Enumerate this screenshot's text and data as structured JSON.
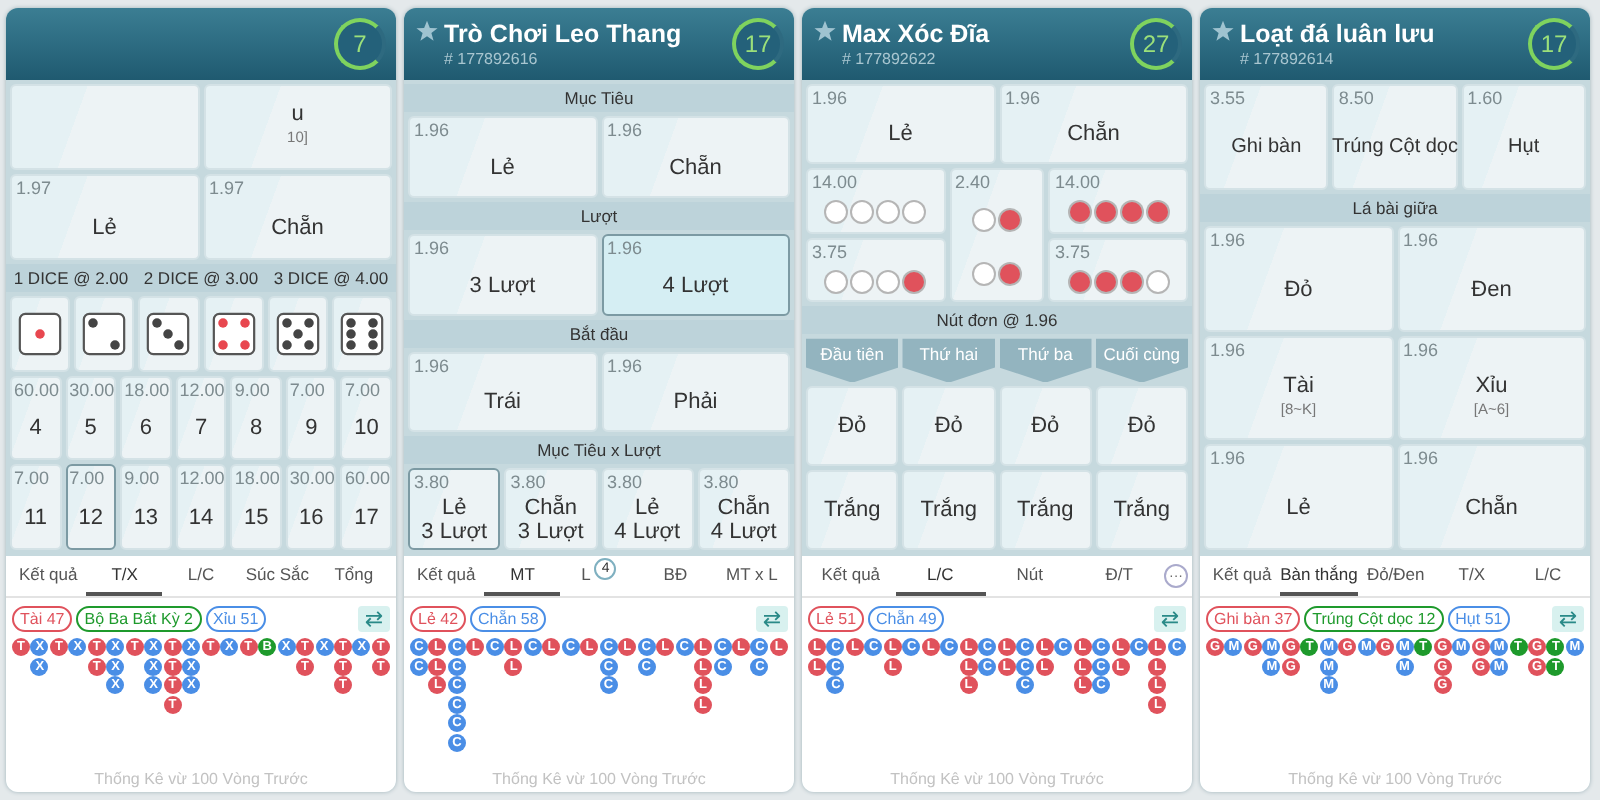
{
  "panels": [
    {
      "count": "7",
      "blocks": [
        {
          "kind": "row",
          "cells": [
            {
              "selected": false
            },
            {
              "label": "u",
              "sub": "10]",
              "selected": false
            }
          ]
        },
        {
          "kind": "row",
          "cells": [
            {
              "odds": "1.97",
              "label": "Lẻ",
              "selected": false
            },
            {
              "odds": "1.97",
              "label": "Chẵn",
              "selected": false
            }
          ]
        },
        {
          "kind": "bar",
          "labels": [
            "1 DICE @ 2.00",
            "2 DICE @ 3.00",
            "3 DICE @ 4.00"
          ]
        },
        {
          "kind": "dice",
          "dice": [
            {
              "kind": "one",
              "color": "#e8474f"
            },
            {
              "kind": "two",
              "color": "#444444"
            },
            {
              "kind": "three",
              "color": "#444444"
            },
            {
              "kind": "four",
              "color": "#e8474f"
            },
            {
              "kind": "five",
              "color": "#444444"
            },
            {
              "kind": "six",
              "color": "#444444"
            }
          ]
        },
        {
          "kind": "row",
          "cells": [
            {
              "odds": "60.00",
              "label": "4",
              "selected": false
            },
            {
              "odds": "30.00",
              "label": "5",
              "selected": false
            },
            {
              "odds": "18.00",
              "label": "6",
              "selected": false
            },
            {
              "odds": "12.00",
              "label": "7",
              "selected": false
            },
            {
              "odds": "9.00",
              "label": "8",
              "selected": false
            },
            {
              "odds": "7.00",
              "label": "9",
              "selected": false
            },
            {
              "odds": "7.00",
              "label": "10",
              "selected": false
            }
          ]
        },
        {
          "kind": "row",
          "cells": [
            {
              "odds": "7.00",
              "label": "11",
              "selected": false
            },
            {
              "odds": "7.00",
              "label": "12",
              "selected": true
            },
            {
              "odds": "9.00",
              "label": "13",
              "selected": false
            },
            {
              "odds": "12.00",
              "label": "14",
              "selected": false
            },
            {
              "odds": "18.00",
              "label": "15",
              "selected": false
            },
            {
              "odds": "30.00",
              "label": "16",
              "selected": false
            },
            {
              "odds": "60.00",
              "label": "17",
              "selected": false
            }
          ]
        }
      ],
      "tabs": [
        {
          "label": "Kết quả",
          "selected": false
        },
        {
          "label": "T/X",
          "selected": true
        },
        {
          "label": "L/C",
          "selected": false
        },
        {
          "label": "Súc Sắc",
          "selected": false
        },
        {
          "label": "Tổng",
          "selected": false
        }
      ],
      "legend": [
        {
          "label": "Tài 47",
          "color": "#e0525c"
        },
        {
          "label": "Bộ Ba Bất Kỳ 2",
          "color": "#1e9a2c"
        },
        {
          "label": "Xỉu 51",
          "color": "#4a8ee6"
        }
      ],
      "swap": "⇄",
      "columns": [
        {
          "color": "#e0525c",
          "beads": [
            "T"
          ]
        },
        {
          "color": "#4a8ee6",
          "beads": [
            "X",
            "X"
          ]
        },
        {
          "color": "#e0525c",
          "beads": [
            "T"
          ]
        },
        {
          "color": "#4a8ee6",
          "beads": [
            "X"
          ]
        },
        {
          "color": "#e0525c",
          "beads": [
            "T",
            "T"
          ]
        },
        {
          "color": "#4a8ee6",
          "beads": [
            "X",
            "X",
            "X"
          ]
        },
        {
          "color": "#e0525c",
          "beads": [
            "T"
          ]
        },
        {
          "color": "#4a8ee6",
          "beads": [
            "X",
            "X",
            "X"
          ]
        },
        {
          "color": "#e0525c",
          "beads": [
            "T",
            "T",
            "T",
            "T"
          ]
        },
        {
          "color": "#4a8ee6",
          "beads": [
            "X",
            "X",
            "X"
          ]
        },
        {
          "color": "#e0525c",
          "beads": [
            "T"
          ]
        },
        {
          "color": "#4a8ee6",
          "beads": [
            "X"
          ]
        },
        {
          "color": "#e0525c",
          "beads": [
            "T"
          ]
        },
        {
          "color": "#1e9a2c",
          "beads": [
            "B"
          ]
        },
        {
          "color": "#4a8ee6",
          "beads": [
            "X"
          ]
        },
        {
          "color": "#e0525c",
          "beads": [
            "T",
            "T"
          ]
        },
        {
          "color": "#4a8ee6",
          "beads": [
            "X"
          ]
        },
        {
          "color": "#e0525c",
          "beads": [
            "T",
            "T",
            "T"
          ]
        },
        {
          "color": "#4a8ee6",
          "beads": [
            "X"
          ]
        },
        {
          "color": "#e0525c",
          "beads": [
            "T",
            "T"
          ]
        }
      ],
      "caption": "Thống Kê vừ 100 Vòng Trước"
    },
    {
      "title": "Trò Chơi Leo Thang",
      "round": "# 177892616",
      "count": "17",
      "blocks": [
        {
          "kind": "section",
          "label": "Mục Tiêu"
        },
        {
          "kind": "row",
          "cells": [
            {
              "odds": "1.96",
              "label": "Lẻ",
              "selected": false
            },
            {
              "odds": "1.96",
              "label": "Chẵn",
              "selected": false
            }
          ]
        },
        {
          "kind": "section",
          "label": "Lượt"
        },
        {
          "kind": "row",
          "cells": [
            {
              "odds": "1.96",
              "label": "3 Lượt",
              "selected": false
            },
            {
              "odds": "1.96",
              "label": "4 Lượt",
              "selected": true
            }
          ]
        },
        {
          "kind": "section",
          "label": "Bắt đầu"
        },
        {
          "kind": "row",
          "cells": [
            {
              "odds": "1.96",
              "label": "Trái",
              "selected": false
            },
            {
              "odds": "1.96",
              "label": "Phải",
              "selected": false
            }
          ]
        },
        {
          "kind": "section",
          "label": "Mục Tiêu x Lượt"
        },
        {
          "kind": "row",
          "cells": [
            {
              "odds": "3.80",
              "label": "Lẻ\n3 Lượt",
              "selected": true
            },
            {
              "odds": "3.80",
              "label": "Chẵn\n3 Lượt",
              "selected": false
            },
            {
              "odds": "3.80",
              "label": "Lẻ\n4 Lượt",
              "selected": false
            },
            {
              "odds": "3.80",
              "label": "Chẵn\n4 Lượt",
              "selected": false
            }
          ]
        }
      ],
      "tabs": [
        {
          "label": "Kết quả",
          "selected": false
        },
        {
          "label": "MT",
          "selected": true
        },
        {
          "label": "L",
          "badge": "4",
          "selected": false
        },
        {
          "label": "BĐ",
          "selected": false
        },
        {
          "label": "MT x L",
          "selected": false
        }
      ],
      "legend": [
        {
          "label": "Lẻ 42",
          "color": "#e0525c"
        },
        {
          "label": "Chẵn 58",
          "color": "#4a8ee6"
        }
      ],
      "swap": "⇄",
      "columns": [
        {
          "color": "#4a8ee6",
          "beads": [
            "C",
            "C"
          ]
        },
        {
          "color": "#e0525c",
          "beads": [
            "L",
            "L",
            "L"
          ]
        },
        {
          "color": "#4a8ee6",
          "beads": [
            "C",
            "C",
            "C",
            "C",
            "C",
            "C"
          ]
        },
        {
          "color": "#e0525c",
          "beads": [
            "L"
          ]
        },
        {
          "color": "#4a8ee6",
          "beads": [
            "C"
          ]
        },
        {
          "color": "#e0525c",
          "beads": [
            "L",
            "L"
          ]
        },
        {
          "color": "#4a8ee6",
          "beads": [
            "C"
          ]
        },
        {
          "color": "#e0525c",
          "beads": [
            "L"
          ]
        },
        {
          "color": "#4a8ee6",
          "beads": [
            "C"
          ]
        },
        {
          "color": "#e0525c",
          "beads": [
            "L"
          ]
        },
        {
          "color": "#4a8ee6",
          "beads": [
            "C",
            "C",
            "C"
          ]
        },
        {
          "color": "#e0525c",
          "beads": [
            "L"
          ]
        },
        {
          "color": "#4a8ee6",
          "beads": [
            "C",
            "C"
          ]
        },
        {
          "color": "#e0525c",
          "beads": [
            "L"
          ]
        },
        {
          "color": "#4a8ee6",
          "beads": [
            "C"
          ]
        },
        {
          "color": "#e0525c",
          "beads": [
            "L",
            "L",
            "L",
            "L"
          ]
        },
        {
          "color": "#4a8ee6",
          "beads": [
            "C",
            "C"
          ]
        },
        {
          "color": "#e0525c",
          "beads": [
            "L"
          ]
        },
        {
          "color": "#4a8ee6",
          "beads": [
            "C",
            "C"
          ]
        },
        {
          "color": "#e0525c",
          "beads": [
            "L"
          ]
        }
      ],
      "caption": "Thống Kê vừ 100 Vòng Trước"
    },
    {
      "title": "Max Xóc Đĩa",
      "round": "# 177892622",
      "count": "27",
      "blocks": [
        {
          "kind": "row",
          "cells": [
            {
              "odds": "1.96",
              "label": "Lẻ",
              "selected": false
            },
            {
              "odds": "1.96",
              "label": "Chẵn",
              "selected": false
            }
          ]
        },
        {
          "kind": "discs",
          "cells": [
            {
              "odds": "14.00",
              "discs": [
                {
                  "color": "#ffffff"
                },
                {
                  "color": "#ffffff"
                },
                {
                  "color": "#ffffff"
                },
                {
                  "color": "#ffffff"
                }
              ]
            },
            {
              "odds": "3.75",
              "discs": [
                {
                  "color": "#ffffff"
                },
                {
                  "color": "#ffffff"
                },
                {
                  "color": "#ffffff"
                },
                {
                  "color": "#e0525c"
                }
              ]
            },
            {
              "odds": "2.40",
              "discs": [
                {
                  "color": "#ffffff"
                },
                {
                  "color": "#e0525c"
                },
                {
                  "color": "#ffffff"
                },
                {
                  "color": "#e0525c"
                }
              ]
            },
            {
              "odds": "14.00",
              "discs": [
                {
                  "color": "#e0525c"
                },
                {
                  "color": "#e0525c"
                },
                {
                  "color": "#e0525c"
                },
                {
                  "color": "#e0525c"
                }
              ]
            },
            {
              "odds": "3.75",
              "discs": [
                {
                  "color": "#e0525c"
                },
                {
                  "color": "#e0525c"
                },
                {
                  "color": "#e0525c"
                },
                {
                  "color": "#ffffff"
                }
              ]
            }
          ]
        },
        {
          "kind": "section",
          "label": "Nút đơn @ 1.96"
        },
        {
          "kind": "heads",
          "labels": [
            "Đầu tiên",
            "Thứ hai",
            "Thứ ba",
            "Cuối cùng"
          ]
        },
        {
          "kind": "row",
          "cells": [
            {
              "label": "Đỏ",
              "selected": false
            },
            {
              "label": "Đỏ",
              "selected": false
            },
            {
              "label": "Đỏ",
              "selected": false
            },
            {
              "label": "Đỏ",
              "selected": false
            }
          ]
        },
        {
          "kind": "row",
          "cells": [
            {
              "label": "Trắng",
              "selected": false
            },
            {
              "label": "Trắng",
              "selected": false
            },
            {
              "label": "Trắng",
              "selected": false
            },
            {
              "label": "Trắng",
              "selected": false
            }
          ]
        }
      ],
      "tabs": [
        {
          "label": "Kết quả",
          "selected": false
        },
        {
          "label": "L/C",
          "selected": true
        },
        {
          "label": "Nút",
          "selected": false
        },
        {
          "label": "Đ/T",
          "selected": false
        }
      ],
      "more": "···",
      "legend": [
        {
          "label": "Lẻ 51",
          "color": "#e0525c"
        },
        {
          "label": "Chẵn 49",
          "color": "#4a8ee6"
        }
      ],
      "swap": "⇄",
      "columns": [
        {
          "color": "#e0525c",
          "beads": [
            "L",
            "L"
          ]
        },
        {
          "color": "#4a8ee6",
          "beads": [
            "C",
            "C",
            "C"
          ]
        },
        {
          "color": "#e0525c",
          "beads": [
            "L"
          ]
        },
        {
          "color": "#4a8ee6",
          "beads": [
            "C"
          ]
        },
        {
          "color": "#e0525c",
          "beads": [
            "L",
            "L"
          ]
        },
        {
          "color": "#4a8ee6",
          "beads": [
            "C"
          ]
        },
        {
          "color": "#e0525c",
          "beads": [
            "L"
          ]
        },
        {
          "color": "#4a8ee6",
          "beads": [
            "C"
          ]
        },
        {
          "color": "#e0525c",
          "beads": [
            "L",
            "L",
            "L"
          ]
        },
        {
          "color": "#4a8ee6",
          "beads": [
            "C",
            "C"
          ]
        },
        {
          "color": "#e0525c",
          "beads": [
            "L",
            "L"
          ]
        },
        {
          "color": "#4a8ee6",
          "beads": [
            "C",
            "C",
            "C"
          ]
        },
        {
          "color": "#e0525c",
          "beads": [
            "L",
            "L"
          ]
        },
        {
          "color": "#4a8ee6",
          "beads": [
            "C"
          ]
        },
        {
          "color": "#e0525c",
          "beads": [
            "L",
            "L",
            "L"
          ]
        },
        {
          "color": "#4a8ee6",
          "beads": [
            "C",
            "C",
            "C"
          ]
        },
        {
          "color": "#e0525c",
          "beads": [
            "L",
            "L"
          ]
        },
        {
          "color": "#4a8ee6",
          "beads": [
            "C"
          ]
        },
        {
          "color": "#e0525c",
          "beads": [
            "L",
            "L",
            "L",
            "L"
          ]
        },
        {
          "color": "#4a8ee6",
          "beads": [
            "C"
          ]
        }
      ],
      "caption": "Thống Kê vừ 100 Vòng Trước"
    },
    {
      "title": "Loạt đá luân lưu",
      "round": "# 177892614",
      "count": "17",
      "blocks": [
        {
          "kind": "row",
          "cells": [
            {
              "odds": "3.55",
              "label": "Ghi bàn",
              "selected": false
            },
            {
              "odds": "8.50",
              "label": "Trúng Cột dọc",
              "selected": false
            },
            {
              "odds": "1.60",
              "label": "Hụt",
              "selected": false
            }
          ]
        },
        {
          "kind": "section",
          "label": "Lá bài giữa"
        },
        {
          "kind": "row",
          "cells": [
            {
              "odds": "1.96",
              "label": "Đỏ",
              "selected": false
            },
            {
              "odds": "1.96",
              "label": "Đen",
              "selected": false
            }
          ]
        },
        {
          "kind": "row",
          "cells": [
            {
              "odds": "1.96",
              "label": "Tài",
              "sub": "[8~K]",
              "selected": false
            },
            {
              "odds": "1.96",
              "label": "Xỉu",
              "sub": "[A~6]",
              "selected": false
            }
          ]
        },
        {
          "kind": "row",
          "cells": [
            {
              "odds": "1.96",
              "label": "Lẻ",
              "selected": false
            },
            {
              "odds": "1.96",
              "label": "Chẵn",
              "selected": false
            }
          ]
        }
      ],
      "tabs": [
        {
          "label": "Kết quả",
          "selected": false
        },
        {
          "label": "Bàn thắng",
          "selected": true
        },
        {
          "label": "Đỏ/Đen",
          "selected": false
        },
        {
          "label": "T/X",
          "selected": false
        },
        {
          "label": "L/C",
          "selected": false
        }
      ],
      "legend": [
        {
          "label": "Ghi bàn 37",
          "color": "#e0525c"
        },
        {
          "label": "Trúng Cột dọc 12",
          "color": "#1e9a2c"
        },
        {
          "label": "Hụt 51",
          "color": "#4a8ee6"
        }
      ],
      "swap": "⇄",
      "columns": [
        {
          "color": "#e0525c",
          "beads": [
            "G"
          ]
        },
        {
          "color": "#4a8ee6",
          "beads": [
            "M"
          ]
        },
        {
          "color": "#e0525c",
          "beads": [
            "G"
          ]
        },
        {
          "color": "#4a8ee6",
          "beads": [
            "M",
            "M"
          ]
        },
        {
          "color": "#e0525c",
          "beads": [
            "G",
            "G"
          ]
        },
        {
          "color": "#1e9a2c",
          "beads": [
            "T"
          ]
        },
        {
          "color": "#4a8ee6",
          "beads": [
            "M",
            "M",
            "M"
          ]
        },
        {
          "color": "#e0525c",
          "beads": [
            "G"
          ]
        },
        {
          "color": "#4a8ee6",
          "beads": [
            "M"
          ]
        },
        {
          "color": "#e0525c",
          "beads": [
            "G"
          ]
        },
        {
          "color": "#4a8ee6",
          "beads": [
            "M",
            "M"
          ]
        },
        {
          "color": "#1e9a2c",
          "beads": [
            "T"
          ]
        },
        {
          "color": "#e0525c",
          "beads": [
            "G",
            "G",
            "G"
          ]
        },
        {
          "color": "#4a8ee6",
          "beads": [
            "M"
          ]
        },
        {
          "color": "#e0525c",
          "beads": [
            "G",
            "G"
          ]
        },
        {
          "color": "#4a8ee6",
          "beads": [
            "M",
            "M"
          ]
        },
        {
          "color": "#1e9a2c",
          "beads": [
            "T"
          ]
        },
        {
          "color": "#e0525c",
          "beads": [
            "G",
            "G"
          ]
        },
        {
          "color": "#1e9a2c",
          "beads": [
            "T",
            "T"
          ]
        },
        {
          "color": "#4a8ee6",
          "beads": [
            "M"
          ]
        }
      ],
      "caption": "Thống Kê vừ 100 Vòng Trước"
    }
  ]
}
